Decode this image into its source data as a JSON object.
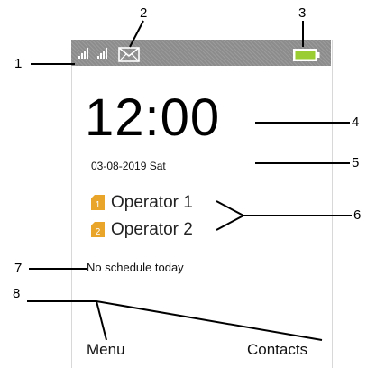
{
  "status_bar": {
    "signal_icons": [
      "signal-sim1-icon",
      "signal-sim2-icon"
    ],
    "message_icon": "envelope-icon",
    "battery_icon": "battery-icon",
    "battery_color": "#9acd32"
  },
  "clock": {
    "time": "12:00",
    "date": "03-08-2019 Sat"
  },
  "operators": [
    {
      "sim_badge": "1",
      "name": "Operator 1"
    },
    {
      "sim_badge": "2",
      "name": "Operator 2"
    }
  ],
  "schedule_text": "No schedule today",
  "softkeys": {
    "left": "Menu",
    "right": "Contacts"
  },
  "callouts": [
    "1",
    "2",
    "3",
    "4",
    "5",
    "6",
    "7",
    "8"
  ],
  "colors": {
    "status_bar": "#8c8c8c",
    "sim_badge": "#e8a52a"
  }
}
